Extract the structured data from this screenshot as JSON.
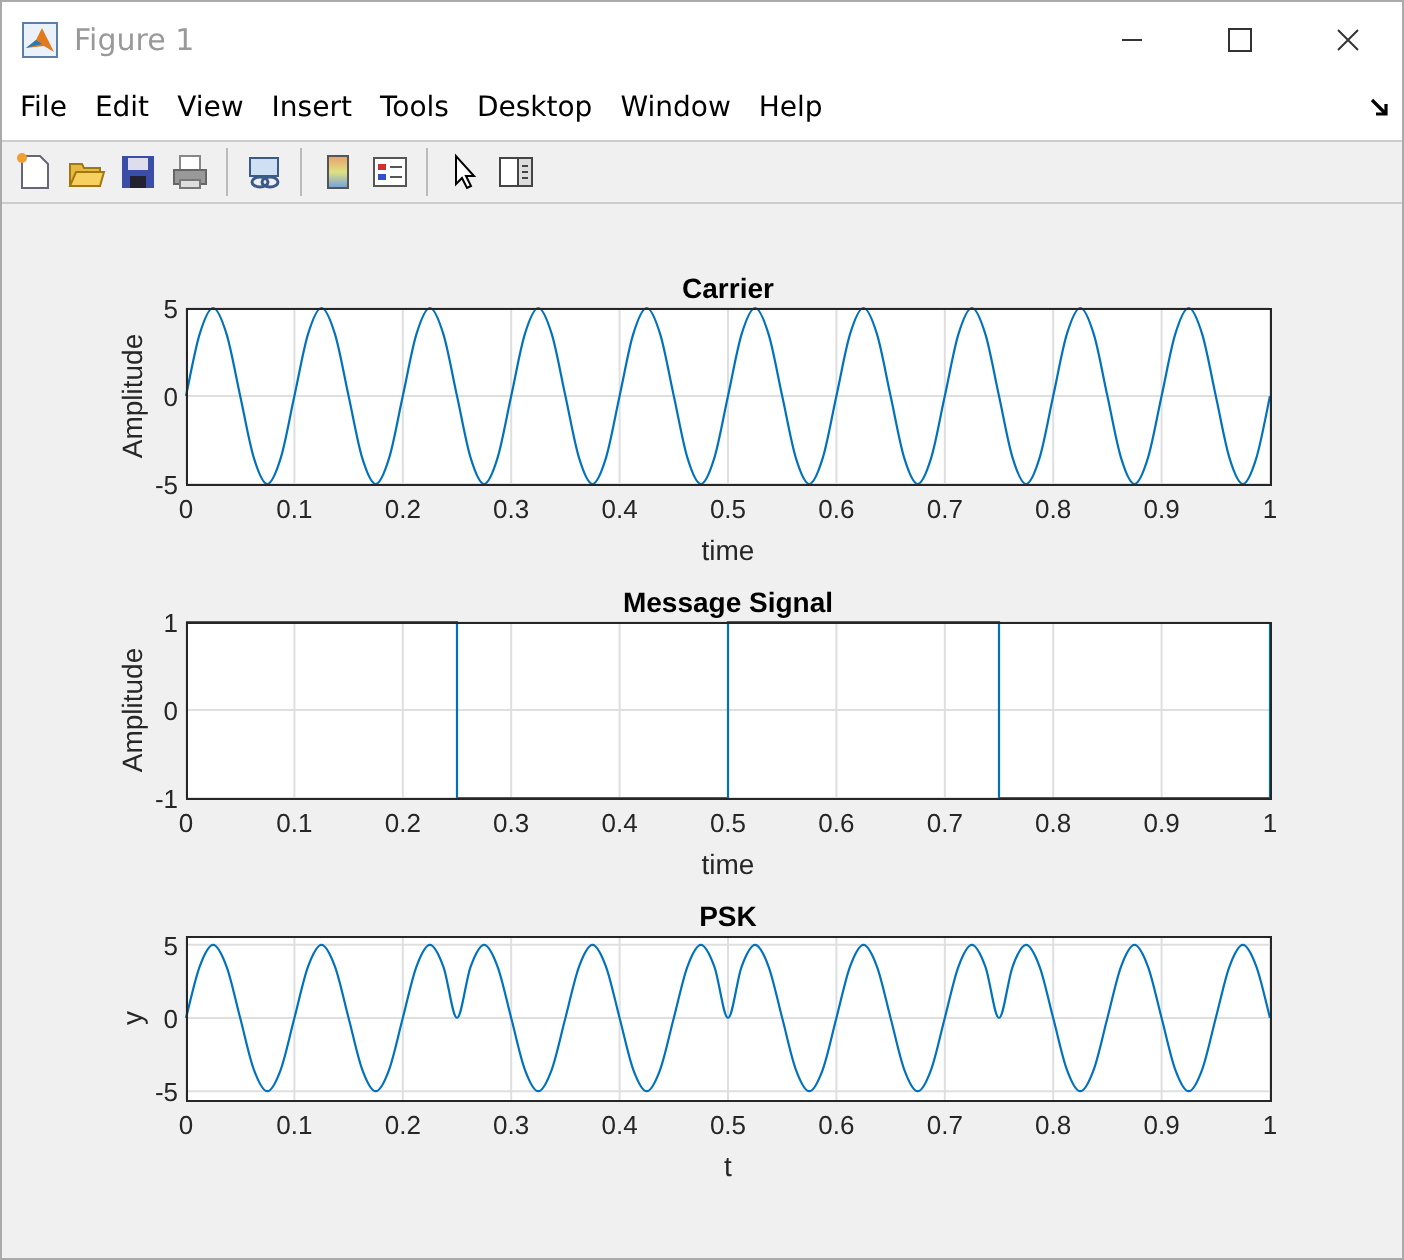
{
  "window": {
    "title": "Figure 1"
  },
  "menu": [
    "File",
    "Edit",
    "View",
    "Insert",
    "Tools",
    "Desktop",
    "Window",
    "Help"
  ],
  "axes": [
    {
      "chart_data": {
        "type": "line",
        "title": "Carrier",
        "xlabel": "time",
        "ylabel": "Amplitude",
        "grid": true,
        "xlim": [
          0,
          1
        ],
        "ylim": [
          -5,
          5
        ],
        "xticks": [
          0,
          0.1,
          0.2,
          0.3,
          0.4,
          0.5,
          0.6,
          0.7,
          0.8,
          0.9,
          1
        ],
        "yticks": [
          -5,
          0,
          5
        ],
        "x": [
          0,
          0.0125,
          0.025,
          0.0375,
          0.05,
          0.0625,
          0.075,
          0.0875,
          0.1,
          0.1125,
          0.125,
          0.1375,
          0.15,
          0.1625,
          0.175,
          0.1875,
          0.2,
          0.2125,
          0.225,
          0.2375,
          0.25,
          0.2625,
          0.275,
          0.2875,
          0.3,
          0.3125,
          0.325,
          0.3375,
          0.35,
          0.3625,
          0.375,
          0.3875,
          0.4,
          0.4125,
          0.425,
          0.4375,
          0.45,
          0.4625,
          0.475,
          0.4875,
          0.5,
          0.5125,
          0.525,
          0.5375,
          0.55,
          0.5625,
          0.575,
          0.5875,
          0.6,
          0.6125,
          0.625,
          0.6375,
          0.65,
          0.6625,
          0.675,
          0.6875,
          0.7,
          0.7125,
          0.725,
          0.7375,
          0.75,
          0.7625,
          0.775,
          0.7875,
          0.8,
          0.8125,
          0.825,
          0.8375,
          0.85,
          0.8625,
          0.875,
          0.8875,
          0.9,
          0.9125,
          0.925,
          0.9375,
          0.95,
          0.9625,
          0.975,
          0.9875,
          1
        ],
        "series": [
          {
            "color": "#0072bd",
            "values": [
              0,
              3.5,
              5,
              3.5,
              0,
              -3.5,
              -5,
              -3.5,
              0,
              3.5,
              5,
              3.5,
              0,
              -3.5,
              -5,
              -3.5,
              0,
              3.5,
              5,
              3.5,
              0,
              -3.5,
              -5,
              -3.5,
              0,
              3.5,
              5,
              3.5,
              0,
              -3.5,
              -5,
              -3.5,
              0,
              3.5,
              5,
              3.5,
              0,
              -3.5,
              -5,
              -3.5,
              0,
              3.5,
              5,
              3.5,
              0,
              -3.5,
              -5,
              -3.5,
              0,
              3.5,
              5,
              3.5,
              0,
              -3.5,
              -5,
              -3.5,
              0,
              3.5,
              5,
              3.5,
              0,
              -3.5,
              -5,
              -3.5,
              0,
              3.5,
              5,
              3.5,
              0,
              -3.5,
              -5,
              -3.5,
              0,
              3.5,
              5,
              3.5,
              0,
              -3.5,
              -5,
              -3.5,
              0
            ]
          }
        ]
      }
    },
    {
      "chart_data": {
        "type": "line",
        "title": "Message Signal",
        "xlabel": "time",
        "ylabel": "Amplitude",
        "grid": true,
        "xlim": [
          0,
          1
        ],
        "ylim": [
          -1,
          1
        ],
        "xticks": [
          0,
          0.1,
          0.2,
          0.3,
          0.4,
          0.5,
          0.6,
          0.7,
          0.8,
          0.9,
          1
        ],
        "yticks": [
          -1,
          0,
          1
        ],
        "x": [
          0,
          0.25,
          0.25,
          0.5,
          0.5,
          0.75,
          0.75,
          1,
          1
        ],
        "series": [
          {
            "color": "#0072bd",
            "values": [
              1,
              1,
              -1,
              -1,
              1,
              1,
              -1,
              -1,
              1
            ]
          }
        ]
      }
    },
    {
      "chart_data": {
        "type": "line",
        "title": "PSK",
        "xlabel": "t",
        "ylabel": "y",
        "grid": true,
        "xlim": [
          0,
          1
        ],
        "ylim": [
          -5.6,
          5.6
        ],
        "xticks": [
          0,
          0.1,
          0.2,
          0.3,
          0.4,
          0.5,
          0.6,
          0.7,
          0.8,
          0.9,
          1
        ],
        "yticks": [
          -5,
          0,
          5
        ],
        "x": [
          0,
          0.0125,
          0.025,
          0.0375,
          0.05,
          0.0625,
          0.075,
          0.0875,
          0.1,
          0.1125,
          0.125,
          0.1375,
          0.15,
          0.1625,
          0.175,
          0.1875,
          0.2,
          0.2125,
          0.225,
          0.2375,
          0.25,
          0.2625,
          0.275,
          0.2875,
          0.3,
          0.3125,
          0.325,
          0.3375,
          0.35,
          0.3625,
          0.375,
          0.3875,
          0.4,
          0.4125,
          0.425,
          0.4375,
          0.45,
          0.4625,
          0.475,
          0.4875,
          0.5,
          0.5125,
          0.525,
          0.5375,
          0.55,
          0.5625,
          0.575,
          0.5875,
          0.6,
          0.6125,
          0.625,
          0.6375,
          0.65,
          0.6625,
          0.675,
          0.6875,
          0.7,
          0.7125,
          0.725,
          0.7375,
          0.75,
          0.7625,
          0.775,
          0.7875,
          0.8,
          0.8125,
          0.825,
          0.8375,
          0.85,
          0.8625,
          0.875,
          0.8875,
          0.9,
          0.9125,
          0.925,
          0.9375,
          0.95,
          0.9625,
          0.975,
          0.9875,
          1
        ],
        "series": [
          {
            "color": "#0072bd",
            "values": [
              0,
              3.5,
              5,
              3.5,
              0,
              -3.5,
              -5,
              -3.5,
              0,
              3.5,
              5,
              3.5,
              0,
              -3.5,
              -5,
              -3.5,
              0,
              3.5,
              5,
              3.5,
              0,
              3.5,
              5,
              3.5,
              0,
              -3.5,
              -5,
              -3.5,
              0,
              3.5,
              5,
              3.5,
              0,
              -3.5,
              -5,
              -3.5,
              0,
              3.5,
              5,
              3.5,
              0,
              3.5,
              5,
              3.5,
              0,
              -3.5,
              -5,
              -3.5,
              0,
              3.5,
              5,
              3.5,
              0,
              -3.5,
              -5,
              -3.5,
              0,
              3.5,
              5,
              3.5,
              0,
              3.5,
              5,
              3.5,
              0,
              -3.5,
              -5,
              -3.5,
              0,
              3.5,
              5,
              3.5,
              0,
              -3.5,
              -5,
              -3.5,
              0,
              3.5,
              5,
              3.5,
              0
            ]
          }
        ]
      }
    }
  ]
}
